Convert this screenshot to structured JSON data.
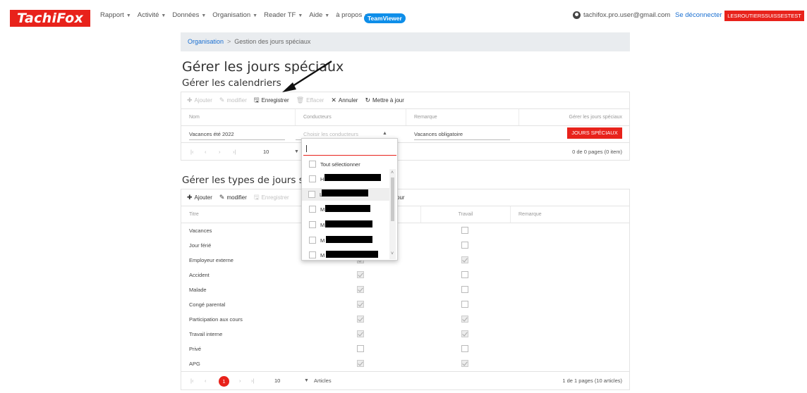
{
  "nav": {
    "logo": "TachiFox",
    "menu": [
      "Rapport",
      "Activité",
      "Données",
      "Organisation",
      "Reader TF",
      "Aide",
      "à propos"
    ],
    "teamviewer": "TeamViewer",
    "user_email": "tachifox.pro.user@gmail.com",
    "logout": "Se déconnecter",
    "org": "LESROUTIERSSUISSESTEST"
  },
  "breadcrumb": {
    "parent": "Organisation",
    "separator": ">",
    "current": "Gestion des jours spéciaux"
  },
  "page_title": "Gérer les jours spéciaux",
  "calendars": {
    "title": "Gérer les calendriers",
    "toolbar": {
      "add": "Ajouter",
      "edit": "modifier",
      "save": "Enregistrer",
      "delete": "Effacer",
      "cancel": "Annuler",
      "refresh": "Mettre à jour"
    },
    "columns": [
      "Nom",
      "Conducteurs",
      "Remarque",
      "Gérer les jours spéciaux"
    ],
    "row": {
      "name": "Vacances été 2022",
      "drivers_placeholder": "Choisir les conducteurs",
      "remark": "Vacances obligatoire",
      "special_days_button": "JOURS SPÉCIAUX"
    },
    "pager": {
      "page_size": "10",
      "info": "0 de 0 pages (0 item)"
    }
  },
  "dropdown": {
    "select_all": "Tout sélectionner",
    "items": [
      "H",
      "L",
      "M",
      "M",
      "M",
      "M"
    ]
  },
  "types": {
    "title": "Gérer les types de jours spéc",
    "toolbar": {
      "add": "Ajouter",
      "edit": "modifier",
      "save": "Enregistrer",
      "refresh_partial": "our"
    },
    "columns": [
      "Titre",
      "Travail",
      "Remarque"
    ],
    "rows": [
      {
        "title": "Vacances",
        "col2": false,
        "travail": false
      },
      {
        "title": "Jour férié",
        "col2": false,
        "travail": false
      },
      {
        "title": "Employeur externe",
        "col2": true,
        "travail": true
      },
      {
        "title": "Accident",
        "col2": true,
        "travail": false
      },
      {
        "title": "Malade",
        "col2": true,
        "travail": false
      },
      {
        "title": "Congé parental",
        "col2": true,
        "travail": false
      },
      {
        "title": "Participation aux cours",
        "col2": true,
        "travail": true
      },
      {
        "title": "Travail interne",
        "col2": true,
        "travail": true
      },
      {
        "title": "Privé",
        "col2": false,
        "travail": false
      },
      {
        "title": "APG",
        "col2": true,
        "travail": true
      }
    ],
    "pager": {
      "current_page": "1",
      "page_size": "10",
      "page_size_label": "Articles",
      "info": "1 de 1 pages (10 articles)"
    }
  },
  "colors": {
    "brand_red": "#e8221b",
    "link_blue": "#1a6fd1",
    "teamviewer_blue": "#0e8ee9"
  }
}
